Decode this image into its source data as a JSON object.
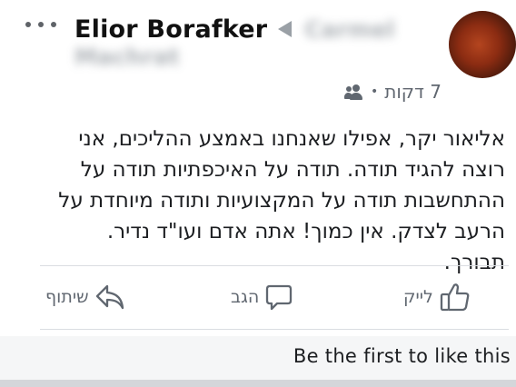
{
  "post": {
    "author": "Elior Borafker",
    "target_group_line1": "Carmel",
    "target_group_line2": "Machrat",
    "timestamp": "7 דקות",
    "separator": "•",
    "audience_icon": "friends-icon",
    "more_icon": "more-dots-icon",
    "text": "אליאור יקר, אפילו שאנחנו באמצע ההליכים, אני רוצה להגיד תודה. תודה על האיכפתיות תודה על ההתחשבות תודה על המקצועיות ותודה מיוחדת על הרעב לצדק. אין כמוך! אתה אדם ועו\"ד נדיר. תבורך."
  },
  "actions": {
    "like_label": "לייק",
    "comment_label": "הגב",
    "share_label": "שיתוף"
  },
  "likes_bar": {
    "text": "Be the first to like this"
  },
  "colors": {
    "text_secondary": "#606770",
    "divider": "#dadde1",
    "likes_bar_bg": "#f5f6f7"
  }
}
